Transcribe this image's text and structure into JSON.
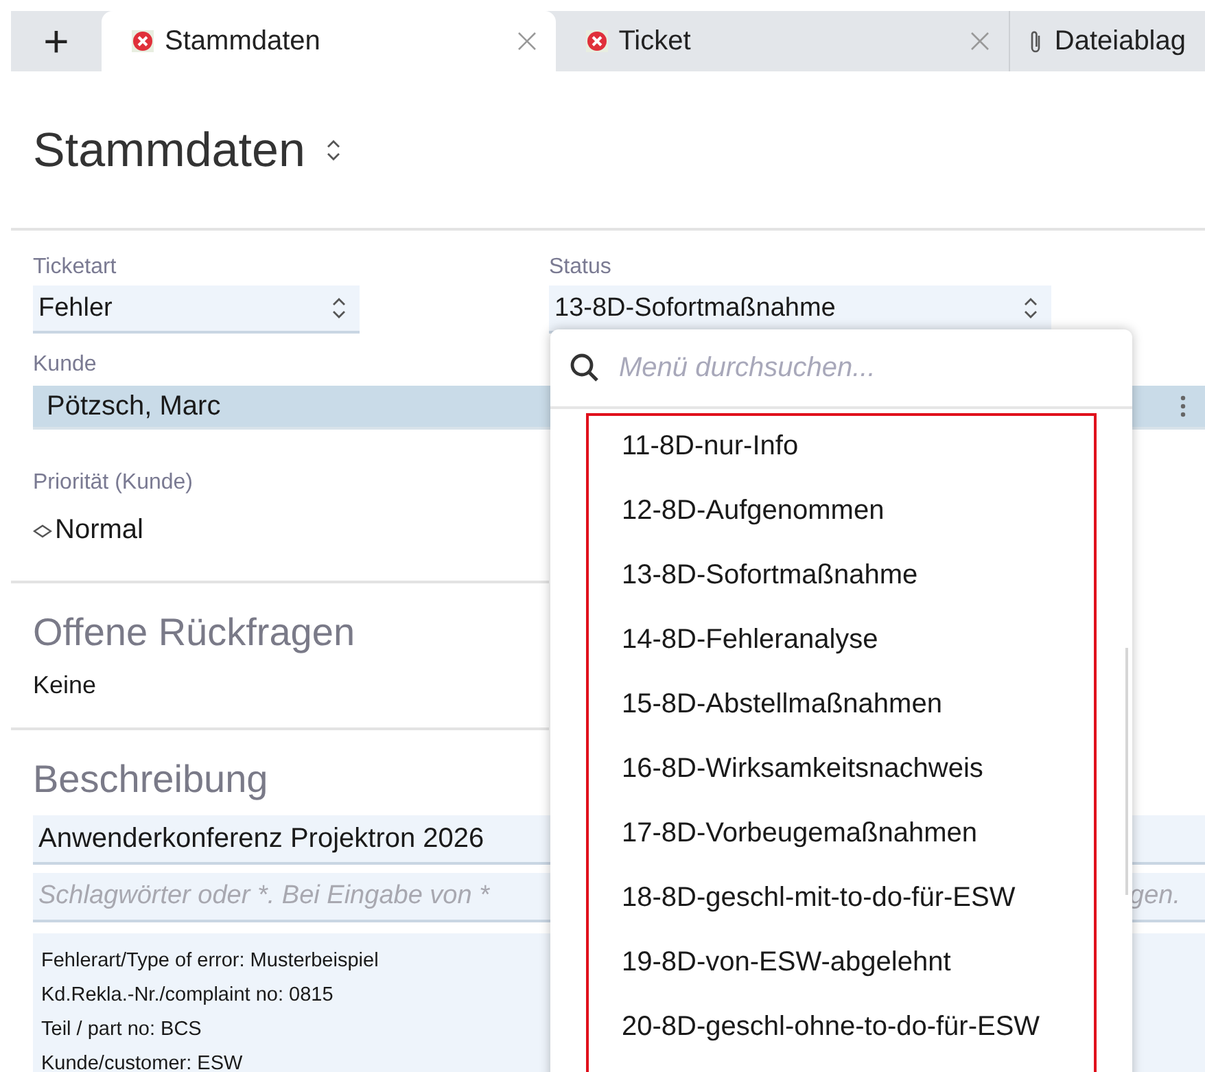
{
  "tabs": [
    {
      "label": "+",
      "kind": "add",
      "selected": false
    },
    {
      "label": "Stammdaten",
      "kind": "error",
      "selected": true
    },
    {
      "label": "Ticket",
      "kind": "error",
      "selected": false
    },
    {
      "label": "Dateiablag",
      "kind": "attachment",
      "selected": false
    }
  ],
  "page_title": "Stammdaten",
  "fields": {
    "ticketart": {
      "label": "Ticketart",
      "value": "Fehler"
    },
    "status": {
      "label": "Status",
      "value": "13-8D-Sofortmaßnahme"
    },
    "kunde": {
      "label": "Kunde",
      "value": "Pötzsch, Marc"
    },
    "prioritaet": {
      "label": "Priorität (Kunde)",
      "value": "Normal"
    }
  },
  "sections": [
    {
      "title": "Offene Rückfragen",
      "text": "Keine"
    },
    {
      "title": "Beschreibung"
    }
  ],
  "description": {
    "title": "Anwenderkonferenz Projektron 2026",
    "keywords_placeholder_start": "Schlagwörter oder *. Bei Eingabe von *",
    "keywords_placeholder_end": "gen.",
    "lines": [
      "Fehlerart/Type of error: Musterbeispiel",
      "Kd.Rekla.-Nr./complaint no: 0815",
      "Teil / part no: BCS",
      "Kunde/customer: ESW"
    ]
  },
  "dropdown": {
    "search_placeholder": "Menü durchsuchen...",
    "highlighted": true,
    "items": [
      "11-8D-nur-Info",
      "12-8D-Aufgenommen",
      "13-8D-Sofortmaßnahme",
      "14-8D-Fehleranalyse",
      "15-8D-Abstellmaßnahmen",
      "16-8D-Wirksamkeitsnachweis",
      "17-8D-Vorbeugemaßnahmen",
      "18-8D-geschl-mit-to-do-für-ESW",
      "19-8D-von-ESW-abgelehnt",
      "20-8D-geschl-ohne-to-do-für-ESW"
    ]
  }
}
